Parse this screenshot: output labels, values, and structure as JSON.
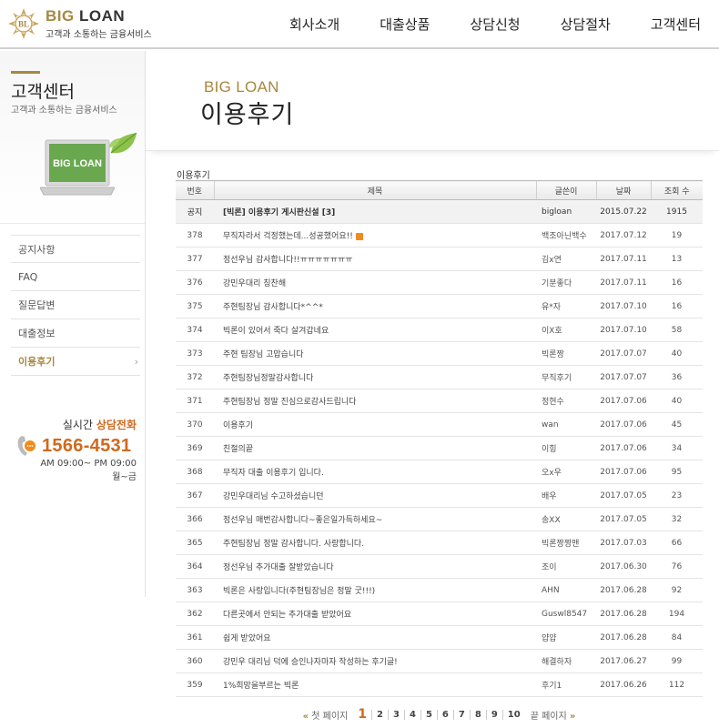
{
  "header": {
    "logo_title_a": "BIG",
    "logo_title_b": "LOAN",
    "logo_sub": "고객과 소통하는 금융서비스",
    "logo_mark": "BL",
    "nav": [
      "회사소개",
      "대출상품",
      "상담신청",
      "상담절차",
      "고객센터"
    ]
  },
  "sidebar": {
    "title": "고객센터",
    "subtitle": "고객과 소통하는 금융서비스",
    "laptop_text": "BIG LOAN",
    "menu": [
      "공지사항",
      "FAQ",
      "질문답변",
      "대출정보",
      "이용후기"
    ],
    "active_index": 4,
    "arrow": "›",
    "contact_label_a": "실시간",
    "contact_label_b": "상담전화",
    "phone": "1566-4531",
    "hours": "AM 09:00~ PM 09:00",
    "days": "월~금"
  },
  "page": {
    "title_eng": "BIG LOAN",
    "title_kor": "이용후기",
    "breadcrumb": "이용후기"
  },
  "table": {
    "headers": [
      "번호",
      "제목",
      "글쓴이",
      "날짜",
      "조회 수"
    ],
    "rows": [
      {
        "num": "공지",
        "subject": "[빅론] 이용후기 게시판신설 [3]",
        "writer": "bigloan",
        "date": "2015.07.22",
        "views": "1915",
        "notice": true
      },
      {
        "num": "378",
        "subject": "무직자라서 걱정했는데...성공했어요!!",
        "writer": "백조아닌백수",
        "date": "2017.07.12",
        "views": "19",
        "new": true
      },
      {
        "num": "377",
        "subject": "정선우님 감사합니다!!ㅠㅠㅠㅠㅠㅠㅠ",
        "writer": "김x연",
        "date": "2017.07.11",
        "views": "13"
      },
      {
        "num": "376",
        "subject": "강민우대리 칭찬해",
        "writer": "기분좋다",
        "date": "2017.07.11",
        "views": "16"
      },
      {
        "num": "375",
        "subject": "주현팀장님 감사합니다*^^*",
        "writer": "유*자",
        "date": "2017.07.10",
        "views": "16"
      },
      {
        "num": "374",
        "subject": "빅론이 있어서 죽다 살겨갑네요",
        "writer": "이X호",
        "date": "2017.07.10",
        "views": "58"
      },
      {
        "num": "373",
        "subject": "주현 팀장님 고맙습니다",
        "writer": "빅론짱",
        "date": "2017.07.07",
        "views": "40"
      },
      {
        "num": "372",
        "subject": "주현팀장님정말감사합니다",
        "writer": "무직후기",
        "date": "2017.07.07",
        "views": "36"
      },
      {
        "num": "371",
        "subject": "주현팀장님 정말 진심으로감사드립니다",
        "writer": "정현수",
        "date": "2017.07.06",
        "views": "40"
      },
      {
        "num": "370",
        "subject": "이용후기",
        "writer": "wan",
        "date": "2017.07.06",
        "views": "45"
      },
      {
        "num": "369",
        "subject": "친절의끝",
        "writer": "이힝",
        "date": "2017.07.06",
        "views": "34"
      },
      {
        "num": "368",
        "subject": "무직자 대출 이용후기 입니다.",
        "writer": "오x우",
        "date": "2017.07.06",
        "views": "95"
      },
      {
        "num": "367",
        "subject": "강민우대리님 수고하셨습니던",
        "writer": "배우",
        "date": "2017.07.05",
        "views": "23"
      },
      {
        "num": "366",
        "subject": "정선우님 매번감사합니다~좋은일가득하세요~",
        "writer": "송XX",
        "date": "2017.07.05",
        "views": "32"
      },
      {
        "num": "365",
        "subject": "주현팀장님 정말 감사합니다. 사랑합니다.",
        "writer": "빅론짱짱맨",
        "date": "2017.07.03",
        "views": "66"
      },
      {
        "num": "364",
        "subject": "정선우님 추가대출 잘받았습니다",
        "writer": "조이",
        "date": "2017.06.30",
        "views": "76"
      },
      {
        "num": "363",
        "subject": "빅론은 사랑입니다(주현팀장님은 정말 굿!!!)",
        "writer": "AHN",
        "date": "2017.06.28",
        "views": "92"
      },
      {
        "num": "362",
        "subject": "다른곳에서 안되는 추가대출 받았어요",
        "writer": "Guswl8547",
        "date": "2017.06.28",
        "views": "194"
      },
      {
        "num": "361",
        "subject": "쉽게 받았어요",
        "writer": "얍얍",
        "date": "2017.06.28",
        "views": "84"
      },
      {
        "num": "360",
        "subject": "강민우 대리님 덕에 승인나자마자 작성하는 후기글!",
        "writer": "해결하자",
        "date": "2017.06.27",
        "views": "99"
      },
      {
        "num": "359",
        "subject": "1%희망을부르는 빅론",
        "writer": "후기1",
        "date": "2017.06.26",
        "views": "112"
      }
    ]
  },
  "pager": {
    "first_label": "첫 페이지",
    "last_label": "끝 페이지",
    "prev_chev": "«",
    "next_chev": "»",
    "pages": [
      "1",
      "2",
      "3",
      "4",
      "5",
      "6",
      "7",
      "8",
      "9",
      "10"
    ],
    "current": "1"
  },
  "colors": {
    "accent_gold": "#a8873f",
    "accent_orange": "#d1691e",
    "laptop_green": "#6aa84f"
  }
}
